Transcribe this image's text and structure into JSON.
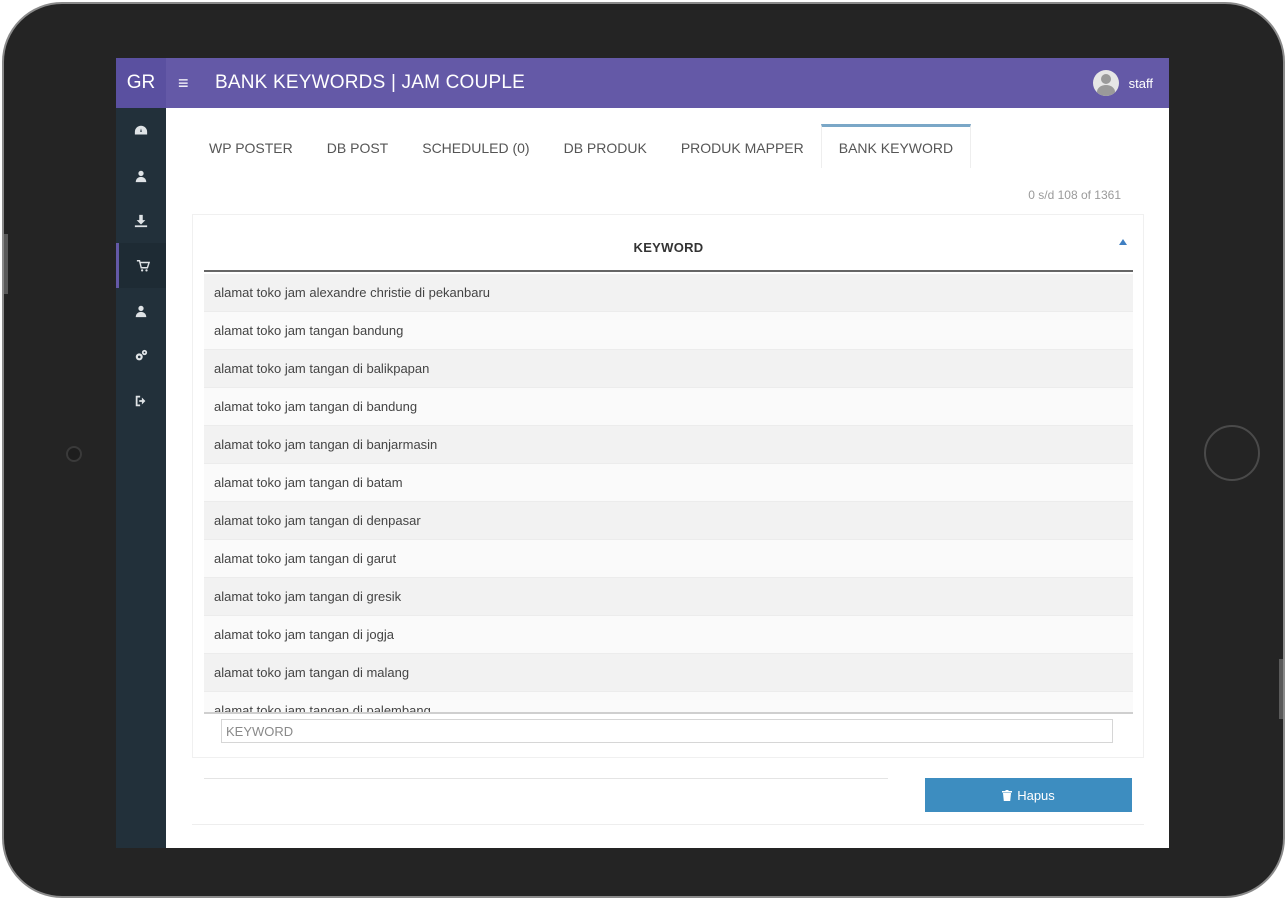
{
  "header": {
    "brand": "GR",
    "menu_icon": "hamburger-icon",
    "title": "BANK KEYWORDS | JAM COUPLE",
    "user_name": "staff"
  },
  "sidebar": {
    "items": [
      {
        "icon": "dashboard-icon",
        "active": false
      },
      {
        "icon": "user-icon",
        "active": false
      },
      {
        "icon": "download-icon",
        "active": false
      },
      {
        "icon": "cart-icon",
        "active": true
      },
      {
        "icon": "user-icon",
        "active": false
      },
      {
        "icon": "settings-icon",
        "active": false
      },
      {
        "icon": "logout-icon",
        "active": false
      }
    ]
  },
  "tabs": [
    {
      "label": "WP POSTER",
      "active": false
    },
    {
      "label": "DB POST",
      "active": false
    },
    {
      "label": "SCHEDULED (0)",
      "active": false
    },
    {
      "label": "DB PRODUK",
      "active": false
    },
    {
      "label": "PRODUK MAPPER",
      "active": false
    },
    {
      "label": "BANK KEYWORD",
      "active": true
    }
  ],
  "count_text": "0 s/d 108 of 1361",
  "table": {
    "column_header": "KEYWORD",
    "rows": [
      "alamat toko jam alexandre christie di pekanbaru",
      "alamat toko jam tangan bandung",
      "alamat toko jam tangan di balikpapan",
      "alamat toko jam tangan di bandung",
      "alamat toko jam tangan di banjarmasin",
      "alamat toko jam tangan di batam",
      "alamat toko jam tangan di denpasar",
      "alamat toko jam tangan di garut",
      "alamat toko jam tangan di gresik",
      "alamat toko jam tangan di jogja",
      "alamat toko jam tangan di malang",
      "alamat toko jam tangan di palembang"
    ],
    "filter_placeholder": "KEYWORD"
  },
  "actions": {
    "delete_label": "Hapus",
    "delete_color": "#3d8dc0"
  },
  "colors": {
    "topbar": "#6459a7",
    "sidebar": "#22303a"
  }
}
